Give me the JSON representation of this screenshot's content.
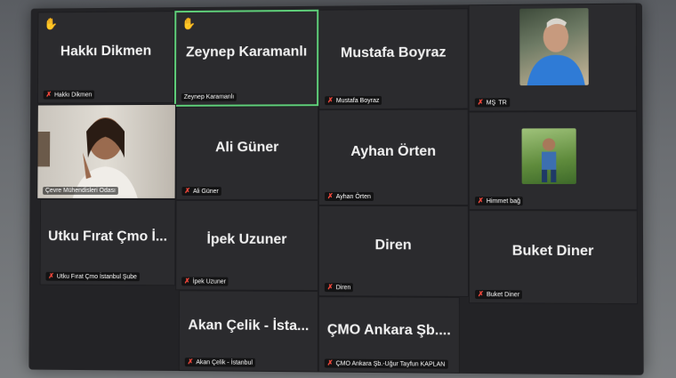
{
  "participants": [
    {
      "name": "Hakkı Dikmen",
      "label": "Hakkı Dikmen",
      "hand": true
    },
    {
      "name": "Zeynep Karamanlı",
      "label": "Zeynep Karamanlı",
      "hand": true,
      "active": true
    },
    {
      "name": "Mustafa Boyraz",
      "label": "Mustafa Boyraz"
    },
    {
      "name": "",
      "label": "MŞ",
      "extra": "TR"
    },
    {
      "name": "",
      "label": "Çevre Mühendisleri Odası"
    },
    {
      "name": "Ali Güner",
      "label": "Ali Güner"
    },
    {
      "name": "Ayhan Örten",
      "label": "Ayhan Örten"
    },
    {
      "name": "",
      "label": "Himmet bağ"
    },
    {
      "name": "Utku Fırat Çmo İ...",
      "label": "Utku Fırat Çmo İstanbul Şube"
    },
    {
      "name": "İpek Uzuner",
      "label": "İpek Uzuner"
    },
    {
      "name": "Diren",
      "label": "Diren"
    },
    {
      "name": "Buket Diner",
      "label": "Buket Diner"
    },
    {
      "name": "Akan Çelik - İsta...",
      "label": "Akan Çelik - İstanbul"
    },
    {
      "name": "ÇMO Ankara Şb....",
      "label": "ÇMO Ankara Şb.-Uğur Tayfun KAPLAN"
    }
  ],
  "icons": {
    "mic_muted": "✗",
    "raised_hand": "✋"
  },
  "colors": {
    "active_speaker": "#5fd07a",
    "muted": "#ff4a3d",
    "tile_bg": "#2b2b2e"
  }
}
